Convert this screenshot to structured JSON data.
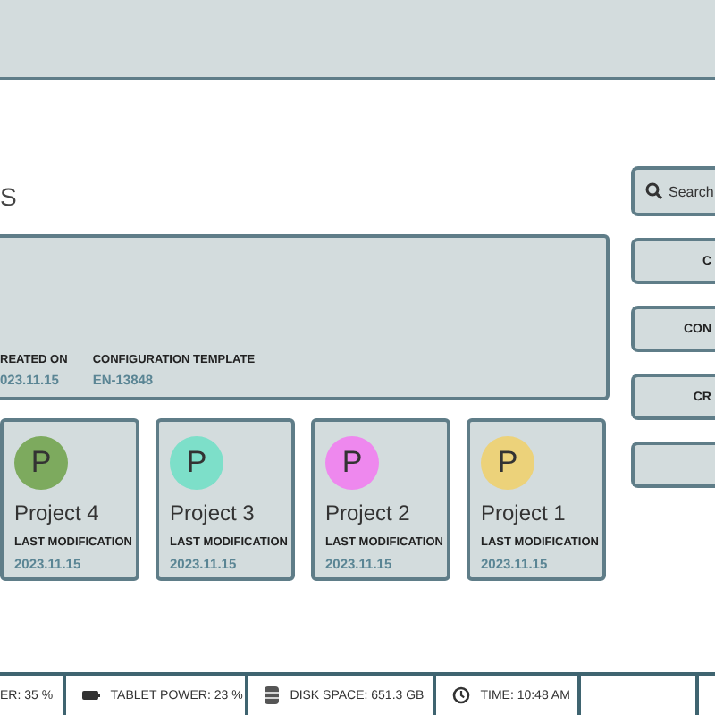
{
  "page_title": "S",
  "overview": {
    "fields": [
      {
        "label": "REATED ON",
        "value": "023.11.15"
      },
      {
        "label": "CONFIGURATION TEMPLATE",
        "value": "EN-13848"
      }
    ]
  },
  "projects": [
    {
      "initial": "P",
      "name": "Project 4",
      "color": "#7daa5e",
      "label": "LAST MODIFICATION",
      "date": "2023.11.15"
    },
    {
      "initial": "P",
      "name": "Project 3",
      "color": "#7ddfc9",
      "label": "LAST MODIFICATION",
      "date": "2023.11.15"
    },
    {
      "initial": "P",
      "name": "Project 2",
      "color": "#ee88ee",
      "label": "LAST MODIFICATION",
      "date": "2023.11.15"
    },
    {
      "initial": "P",
      "name": "Project 1",
      "color": "#ecd27a",
      "label": "LAST MODIFICATION",
      "date": "2023.11.15"
    }
  ],
  "search": {
    "placeholder": "Search"
  },
  "side_buttons": [
    "C",
    "CON",
    "CR"
  ],
  "status_bar": [
    {
      "kind": "plain",
      "text": "ER: 35 %"
    },
    {
      "kind": "battery",
      "text": "TABLET POWER: 23 %"
    },
    {
      "kind": "disk",
      "text": "DISK SPACE: 651.3 GB"
    },
    {
      "kind": "clock",
      "text": "TIME: 10:48 AM"
    }
  ]
}
